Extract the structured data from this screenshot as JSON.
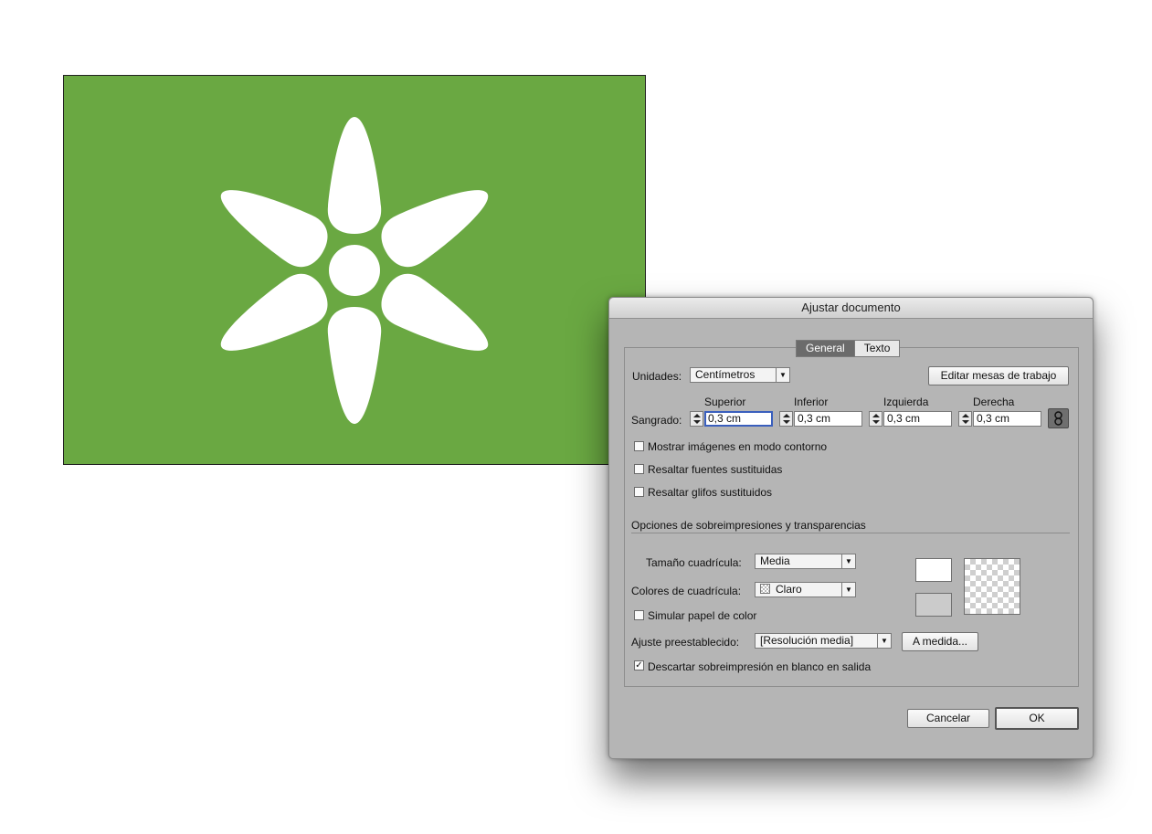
{
  "dialog": {
    "title": "Ajustar documento",
    "tabs": [
      {
        "label": "General",
        "active": true
      },
      {
        "label": "Texto",
        "active": false
      }
    ],
    "units": {
      "label": "Unidades:",
      "value": "Centímetros"
    },
    "edit_artboards_label": "Editar mesas de trabajo",
    "bleed": {
      "label": "Sangrado:",
      "top": {
        "label": "Superior",
        "value": "0,3 cm"
      },
      "bottom": {
        "label": "Inferior",
        "value": "0,3 cm"
      },
      "left": {
        "label": "Izquierda",
        "value": "0,3 cm"
      },
      "right": {
        "label": "Derecha",
        "value": "0,3 cm"
      }
    },
    "checkboxes": [
      {
        "label": "Mostrar imágenes en modo contorno",
        "checked": false
      },
      {
        "label": "Resaltar fuentes sustituidas",
        "checked": false
      },
      {
        "label": "Resaltar glifos sustituidos",
        "checked": false
      }
    ],
    "transparency_section": "Opciones de sobreimpresiones y transparencias",
    "grid_size": {
      "label": "Tamaño cuadrícula:",
      "value": "Media"
    },
    "grid_colors": {
      "label": "Colores de cuadrícula:",
      "value": "Claro"
    },
    "simulate_paper": {
      "label": "Simular papel de color",
      "checked": false
    },
    "preset": {
      "label": "Ajuste preestablecido:",
      "value": "[Resolución media]"
    },
    "custom_label": "A medida...",
    "discard_overprint": {
      "label": "Descartar sobreimpresión en blanco en salida",
      "checked": true
    },
    "cancel_label": "Cancelar",
    "ok_label": "OK"
  },
  "artboard": {
    "background_color": "#6aa842",
    "flower_color": "#ffffff"
  }
}
